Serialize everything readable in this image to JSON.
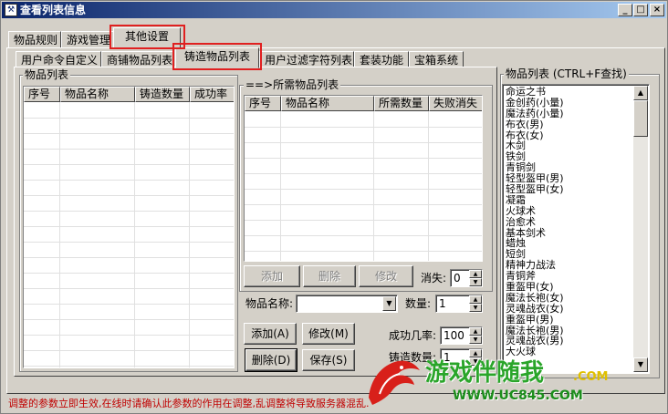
{
  "window": {
    "title": "查看列表信息",
    "controls": {
      "minimize": "_",
      "maximize": "□",
      "close": "×"
    }
  },
  "top_tabs": [
    {
      "label": "物品规则"
    },
    {
      "label": "游戏管理"
    },
    {
      "label": "其他设置",
      "active": true
    }
  ],
  "sub_tabs": [
    {
      "label": "用户命令自定义"
    },
    {
      "label": "商铺物品列表"
    },
    {
      "label": "铸造物品列表",
      "active": true
    },
    {
      "label": "用户过滤字符列表"
    },
    {
      "label": "套装功能"
    },
    {
      "label": "宝箱系统"
    }
  ],
  "item_list_group": {
    "label": "物品列表",
    "columns": [
      "序号",
      "物品名称",
      "铸造数量",
      "成功率"
    ]
  },
  "required_group": {
    "label": "==>所需物品列表",
    "columns": [
      "序号",
      "物品名称",
      "所需数量",
      "失败消失"
    ],
    "buttons": {
      "add": "添加",
      "delete": "删除",
      "modify": "修改"
    },
    "vanish_label": "消失:",
    "vanish_value": "0",
    "item_name_label": "物品名称:",
    "item_name_value": "",
    "quantity_label": "数量:",
    "quantity_value": "1"
  },
  "main_buttons": {
    "add": "添加(A)",
    "modify": "修改(M)",
    "delete": "删除(D)",
    "save": "保存(S)"
  },
  "success_rate_label": "成功几率:",
  "success_rate_value": "100",
  "forge_count_label": "铸造数量:",
  "forge_count_value": "1",
  "item_list_right": {
    "label": "物品列表 (CTRL+F查找)",
    "items": [
      "命运之书",
      "金创药(小量)",
      "魔法药(小量)",
      "布衣(男)",
      "布衣(女)",
      "木剑",
      "铁剑",
      "青铜剑",
      "轻型盔甲(男)",
      "轻型盔甲(女)",
      "凝霜",
      "火球术",
      "治愈术",
      "基本剑术",
      "蜡烛",
      "短剑",
      "精神力战法",
      "青铜斧",
      "重盔甲(女)",
      "魔法长袍(女)",
      "灵魂战衣(女)",
      "重盔甲(男)",
      "魔法长袍(男)",
      "灵魂战衣(男)",
      "大火球"
    ]
  },
  "status_message": "调整的参数立即生效,在线时请确认此参数的作用在调整,乱调整将导致服务器混乱.",
  "watermark": {
    "text": "游戏伴随我",
    "url": "WWW.UC845.COM",
    "com": ".COM"
  },
  "colors": {
    "highlight": "#e02020",
    "status_text": "#c00000",
    "watermark": "#2aa52a"
  }
}
